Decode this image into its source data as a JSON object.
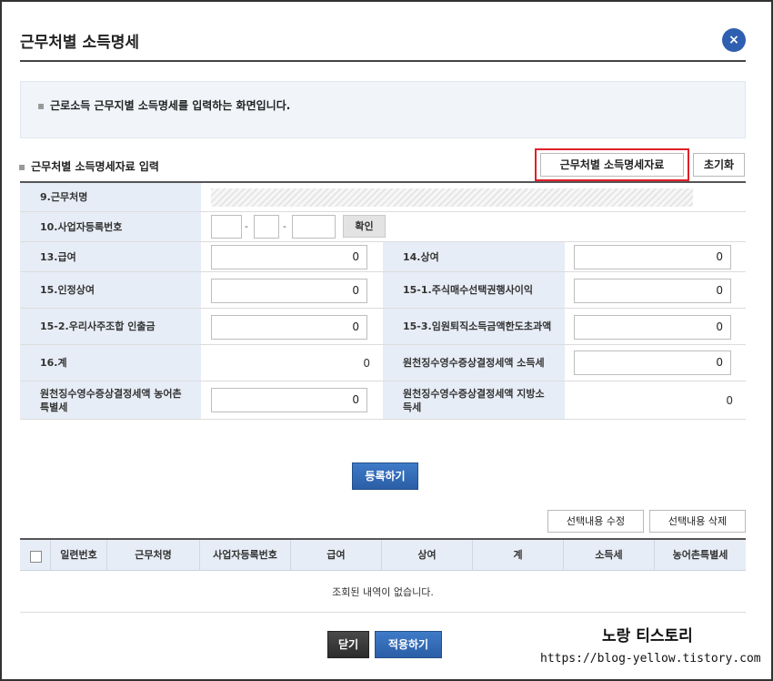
{
  "window": {
    "title": "근무처별 소득명세",
    "close_glyph": "×"
  },
  "info": {
    "text": "근로소득 근무지별 소득명세를 입력하는 화면입니다."
  },
  "section": {
    "title": "근무처별 소득명세자료 입력",
    "btn_data": "근무처별 소득명세자료",
    "btn_reset": "초기화"
  },
  "form": {
    "workplace_label": "9.근무처명",
    "bizno_label": "10.사업자등록번호",
    "bizno_sep": "-",
    "confirm_label": "확인",
    "salary_label": "13.급여",
    "salary_value": "0",
    "bonus_label": "14.상여",
    "bonus_value": "0",
    "deemed_bonus_label": "15.인정상여",
    "deemed_bonus_value": "0",
    "stock_option_label": "15-1.주식매수선택권행사이익",
    "stock_option_value": "0",
    "esop_label": "15-2.우리사주조합 인출금",
    "esop_value": "0",
    "retire_label": "15-3.임원퇴직소득금액한도초과액",
    "retire_value": "0",
    "total_label": "16.계",
    "total_value": "0",
    "tax_income_label": "원천징수영수증상결정세액 소득세",
    "tax_income_value": "0",
    "tax_rural_label": "원천징수영수증상결정세액 농어촌특별세",
    "tax_rural_value": "0",
    "tax_local_label": "원천징수영수증상결정세액 지방소득세",
    "tax_local_value": "0"
  },
  "actions": {
    "register": "등록하기",
    "edit_selected": "선택내용 수정",
    "delete_selected": "선택내용 삭제",
    "close": "닫기",
    "apply": "적용하기"
  },
  "grid": {
    "columns": [
      "일련번호",
      "근무처명",
      "사업자등록번호",
      "급여",
      "상여",
      "계",
      "소득세",
      "농어촌특별세"
    ],
    "empty_message": "조회된 내역이 없습니다."
  },
  "watermark": {
    "name": "노랑 티스토리",
    "url": "https://blog-yellow.tistory.com"
  },
  "colors": {
    "accent": "#2f5fb0",
    "highlight": "#e0202a",
    "label_bg": "#e7edf6"
  }
}
